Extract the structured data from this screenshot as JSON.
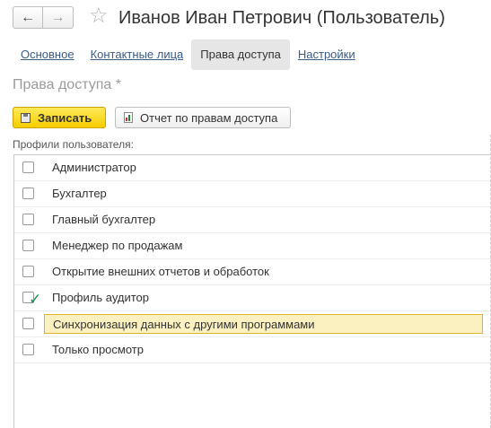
{
  "window": {
    "title": "Иванов Иван Петрович (Пользователь)",
    "back_icon": "←",
    "forward_icon": "→",
    "star_icon": "☆"
  },
  "tabs": [
    {
      "label": "Основное",
      "active": false
    },
    {
      "label": "Контактные лица",
      "active": false
    },
    {
      "label": "Права доступа",
      "active": true
    },
    {
      "label": "Настройки",
      "active": false
    }
  ],
  "section": {
    "title": "Права доступа *"
  },
  "toolbar": {
    "save_label": "Записать",
    "report_label": "Отчет по правам доступа",
    "accent_color": "#f6cd00"
  },
  "profiles": {
    "label": "Профили пользователя:",
    "items": [
      {
        "label": "Администратор",
        "checked": false,
        "selected": false
      },
      {
        "label": "Бухгалтер",
        "checked": false,
        "selected": false
      },
      {
        "label": "Главный бухгалтер",
        "checked": false,
        "selected": false
      },
      {
        "label": "Менеджер по продажам",
        "checked": false,
        "selected": false
      },
      {
        "label": "Открытие внешних отчетов и обработок",
        "checked": false,
        "selected": false
      },
      {
        "label": "Профиль аудитор",
        "checked": true,
        "selected": false
      },
      {
        "label": "Синхронизация данных с другими программами",
        "checked": false,
        "selected": true
      },
      {
        "label": "Только просмотр",
        "checked": false,
        "selected": false
      }
    ],
    "check_color": "#1e8f4e",
    "selection_color": "#fbf0c0"
  }
}
